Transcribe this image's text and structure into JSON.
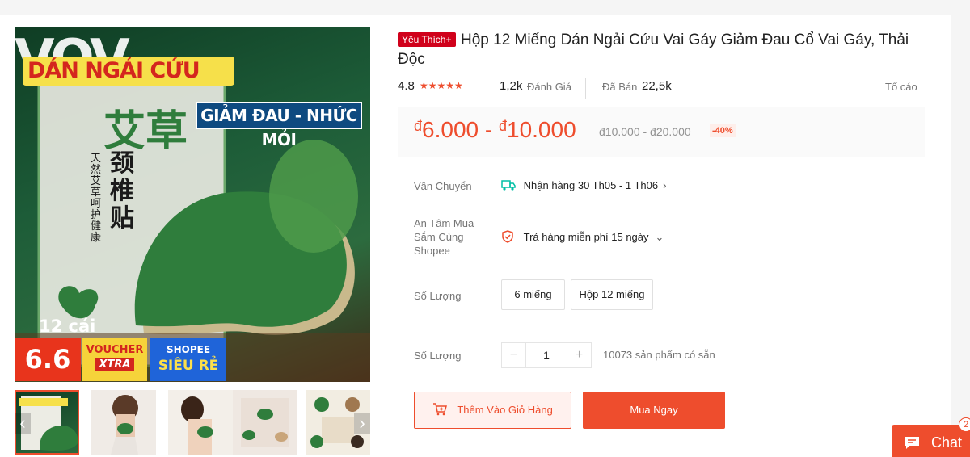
{
  "gallery": {
    "watermark": "VOV",
    "banner_title": "DÁN NGẢI CỨU",
    "banner_sub": "GIẢM ĐAU - NHỨC MỎI",
    "chinese_title": "艾草",
    "chinese_sub": "颈椎贴",
    "chinese_side": "天然艾草 呵护健康",
    "count_badge": "12 cái",
    "promo_66": "6.6",
    "promo_voucher_top": "VOUCHER",
    "promo_voucher_bottom": "XTRA",
    "promo_shopee_top": "SHOPEE",
    "promo_shopee_bottom": "SIÊU RẺ",
    "arrow_left": "‹",
    "arrow_right": "›"
  },
  "product": {
    "badge": "Yêu Thích+",
    "title": "Hộp 12 Miếng Dán Ngải Cứu Vai Gáy Giảm Đau Cổ Vai Gáy, Thải Độc",
    "rating": "4.8",
    "stars": "★★★★★",
    "reviews_count": "1,2k",
    "reviews_label": "Đánh Giá",
    "sold_label": "Đã Bán",
    "sold_count": "22,5k",
    "report_label": "Tố cáo"
  },
  "price": {
    "currency": "đ",
    "low": "6.000",
    "high": "10.000",
    "separator": "-",
    "old": "đ10.000 - đ20.000",
    "discount": "-40%"
  },
  "shipping": {
    "label": "Vận Chuyển",
    "value": "Nhận hàng 30 Th05 - 1 Th06",
    "icon": "truck-icon"
  },
  "assurance": {
    "label": "An Tâm Mua Sắm Cùng Shopee",
    "value": "Trả hàng miễn phí 15 ngày",
    "icon": "shield-icon"
  },
  "variants": {
    "label": "Số Lượng",
    "options": [
      "6 miếng",
      "Hộp 12 miếng"
    ]
  },
  "quantity": {
    "label": "Số Lượng",
    "value": "1",
    "minus": "−",
    "plus": "+",
    "stock": "10073 sản phẩm có sẵn"
  },
  "actions": {
    "add_to_cart": "Thêm Vào Giỏ Hàng",
    "buy_now": "Mua Ngay"
  },
  "chat": {
    "label": "Chat",
    "count": "2"
  },
  "colors": {
    "accent": "#ee4d2d",
    "badge_red": "#d0011b",
    "ship_icon": "#00bfa5"
  }
}
